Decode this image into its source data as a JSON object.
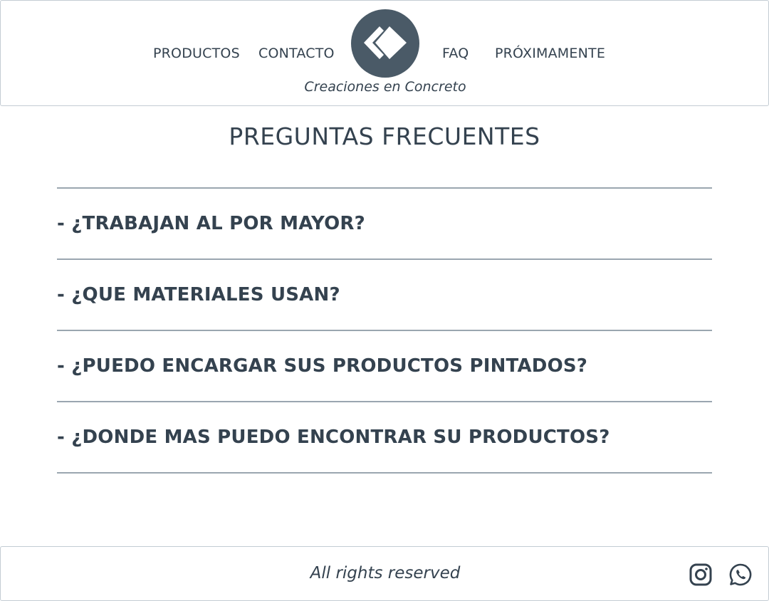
{
  "header": {
    "nav": {
      "productos": "PRODUCTOS",
      "contacto": "CONTACTO",
      "faq": "FAQ",
      "proximamente": "PRÓXIMAMENTE"
    },
    "logo_icon": "diamond-logo-icon",
    "tagline": "Creaciones en Concreto"
  },
  "main": {
    "title": "PREGUNTAS FRECUENTES",
    "faq": [
      {
        "question": "- ¿TRABAJAN AL POR MAYOR?"
      },
      {
        "question": "- ¿QUE MATERIALES USAN?"
      },
      {
        "question": "- ¿PUEDO ENCARGAR SUS PRODUCTOS PINTADOS?"
      },
      {
        "question": "- ¿DONDE MAS PUEDO ENCONTRAR SU PRODUCTOS?"
      }
    ]
  },
  "footer": {
    "text": "All rights reserved",
    "social_icons": [
      "instagram-icon",
      "whatsapp-icon"
    ]
  },
  "colors": {
    "text": "#34424f",
    "logo_background": "#4a5a67",
    "divider": "#9aa6b0",
    "border": "#c3ccd3"
  }
}
